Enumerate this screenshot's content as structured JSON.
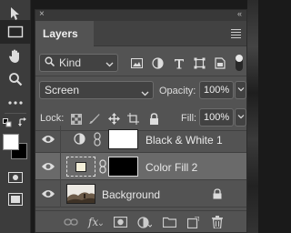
{
  "tools": [
    {
      "name": "move-tool"
    },
    {
      "name": "rectangular-marquee-tool"
    },
    {
      "name": "hand-tool"
    },
    {
      "name": "zoom-tool"
    },
    {
      "name": "more-tools"
    }
  ],
  "colors": {
    "foreground": "#ffffff",
    "background": "#000000"
  },
  "panel": {
    "close_glyph": "×",
    "collapse_glyph": "«",
    "tab_label": "Layers"
  },
  "filter": {
    "kind_label": "Kind"
  },
  "blend": {
    "mode": "Screen",
    "opacity_label": "Opacity:",
    "opacity_value": "100%"
  },
  "lock": {
    "label": "Lock:",
    "fill_label": "Fill:",
    "fill_value": "100%"
  },
  "layers": [
    {
      "name": "Black & White 1",
      "type": "adjustment",
      "selected": false
    },
    {
      "name": "Color Fill 2",
      "type": "fill",
      "fill_color": "#f4f0da",
      "selected": true
    },
    {
      "name": "Background",
      "type": "image",
      "locked": true,
      "selected": false
    }
  ],
  "footer": {
    "fx_label": "fx"
  }
}
